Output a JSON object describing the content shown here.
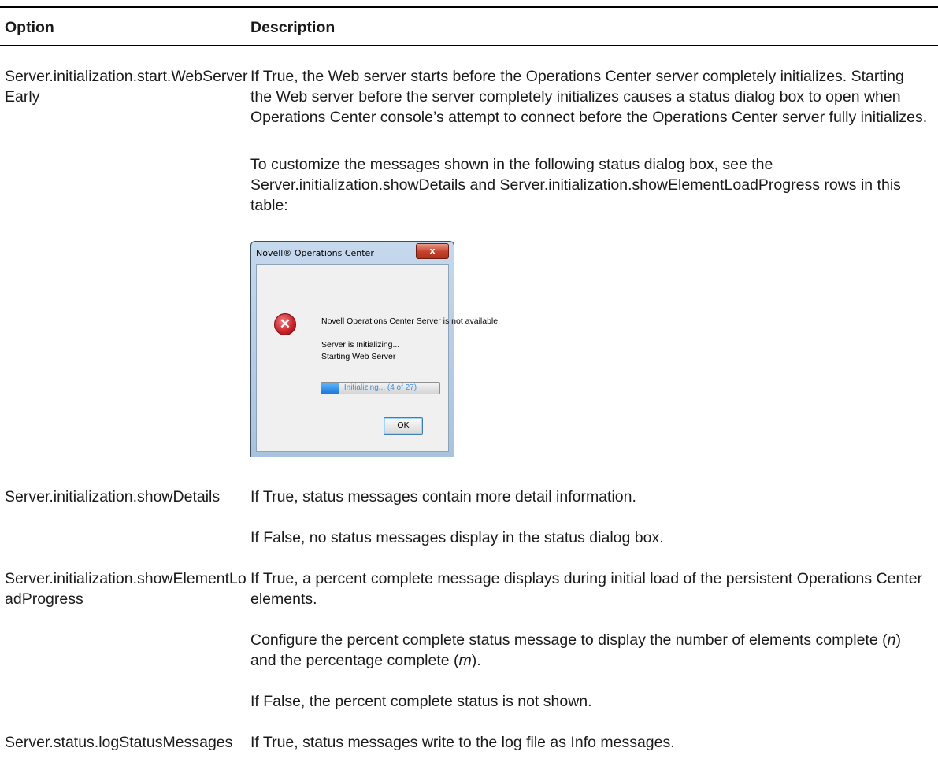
{
  "header": {
    "option_label": "Option",
    "description_label": "Description"
  },
  "rows": [
    {
      "option": "Server.initialization.start.WebServerEarly",
      "paragraphs": [
        "If True, the Web server starts before the Operations Center server completely initializes. Starting the Web server before the server completely initializes causes a status dialog box to open when Operations Center console’s attempt to connect before the Operations Center server fully initializes.",
        "To customize the messages shown in the following status dialog box, see the Server.initialization.showDetails and Server.initialization.showElementLoadProgress rows in this table:"
      ]
    },
    {
      "option": "Server.initialization.showDetails",
      "paragraphs": [
        "If True, status messages contain more detail information.",
        "If False, no status messages display in the status dialog box."
      ]
    },
    {
      "option": "Server.initialization.showElementLoadProgress",
      "paragraphs": [
        "If True, a percent complete message displays during initial load of the persistent Operations Center elements.",
        "Configure the percent complete status message to display the number of elements complete (",
        "n",
        ") and the percentage complete (",
        "m",
        ").",
        "If False, the percent complete status is not shown."
      ]
    },
    {
      "option": "Server.status.logStatusMessages",
      "paragraphs": [
        "If True, status messages write to the log file as Info messages."
      ]
    }
  ],
  "dialog": {
    "title": "Novell® Operations Center",
    "close_glyph": "x",
    "error_glyph": "✕",
    "message": "Novell Operations Center Server is not available.",
    "status_line_1": "Server is Initializing...",
    "status_line_2": "Starting Web Server",
    "progress_label": "Initializing... (4 of 27)",
    "progress_fraction": 0.148,
    "ok_label": "OK"
  }
}
